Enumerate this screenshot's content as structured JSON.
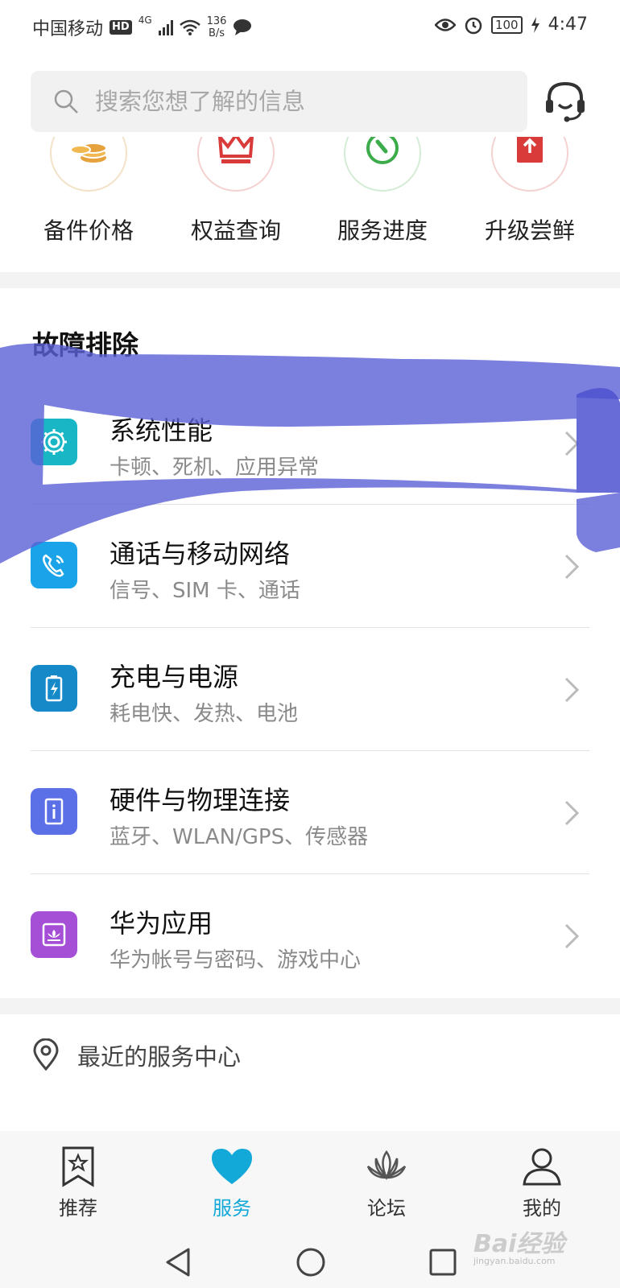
{
  "status_bar": {
    "carrier": "中国移动",
    "hd": "HD",
    "network": "4G",
    "speed_value": "136",
    "speed_unit": "B/s",
    "battery": "100",
    "time": "4:47"
  },
  "search": {
    "placeholder": "搜索您想了解的信息"
  },
  "quick_entries": [
    {
      "label": "备件价格",
      "icon": "coins-icon",
      "color": "#e6a23c"
    },
    {
      "label": "权益查询",
      "icon": "crown-icon",
      "color": "#d93b3b"
    },
    {
      "label": "服务进度",
      "icon": "wrench-icon",
      "color": "#3cab4a"
    },
    {
      "label": "升级尝鲜",
      "icon": "upgrade-icon",
      "color": "#d93b3b"
    }
  ],
  "troubleshooting": {
    "title": "故障排除",
    "items": [
      {
        "title": "系统性能",
        "subtitle": "卡顿、死机、应用异常",
        "icon": "gear-icon",
        "color": "#19b7c6"
      },
      {
        "title": "通话与移动网络",
        "subtitle": "信号、SIM 卡、通话",
        "icon": "phone-icon",
        "color": "#1aa3e8"
      },
      {
        "title": "充电与电源",
        "subtitle": "耗电快、发热、电池",
        "icon": "battery-icon",
        "color": "#1689c9"
      },
      {
        "title": "硬件与物理连接",
        "subtitle": "蓝牙、WLAN/GPS、传感器",
        "icon": "hardware-icon",
        "color": "#5b6fe6"
      },
      {
        "title": "华为应用",
        "subtitle": "华为帐号与密码、游戏中心",
        "icon": "huawei-app-icon",
        "color": "#a44fd6"
      }
    ]
  },
  "nearby": {
    "label": "最近的服务中心"
  },
  "bottom_nav": [
    {
      "label": "推荐",
      "icon": "bookmark-star-icon",
      "active": false
    },
    {
      "label": "服务",
      "icon": "heart-icon",
      "active": true
    },
    {
      "label": "论坛",
      "icon": "lotus-icon",
      "active": false
    },
    {
      "label": "我的",
      "icon": "person-icon",
      "active": false
    }
  ],
  "watermark": {
    "text": "Bai经验",
    "url": "jingyan.baidu.com"
  },
  "colors": {
    "accent": "#12a8d8",
    "annotation": "#5a5fd6"
  }
}
